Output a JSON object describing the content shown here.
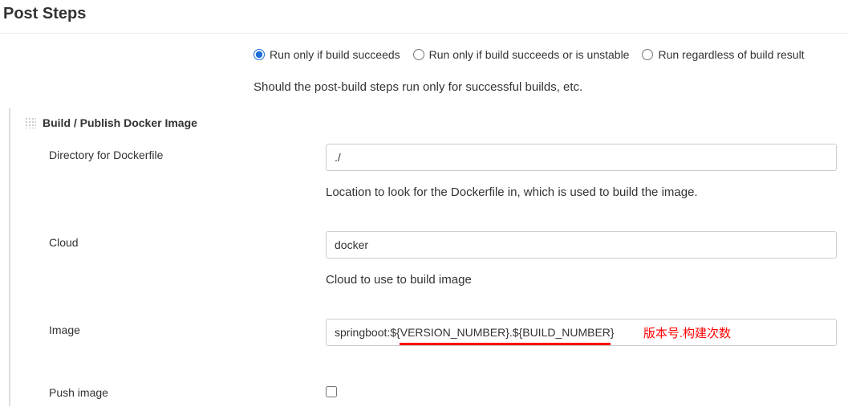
{
  "section_title": "Post Steps",
  "radios": {
    "option1": "Run only if build succeeds",
    "option2": "Run only if build succeeds or is unstable",
    "option3": "Run regardless of build result",
    "selected": "option1"
  },
  "description": "Should the post-build steps run only for successful builds, etc.",
  "block": {
    "title": "Build / Publish Docker Image",
    "fields": {
      "directory": {
        "label": "Directory for Dockerfile",
        "value": "./",
        "help": "Location to look for the Dockerfile in, which is used to build the image."
      },
      "cloud": {
        "label": "Cloud",
        "value": "docker",
        "help": "Cloud to use to build image"
      },
      "image": {
        "label": "Image",
        "value": "springboot:${VERSION_NUMBER}.${BUILD_NUMBER}",
        "annotation": "版本号.构建次数"
      },
      "push": {
        "label": "Push image",
        "checked": false
      }
    }
  }
}
